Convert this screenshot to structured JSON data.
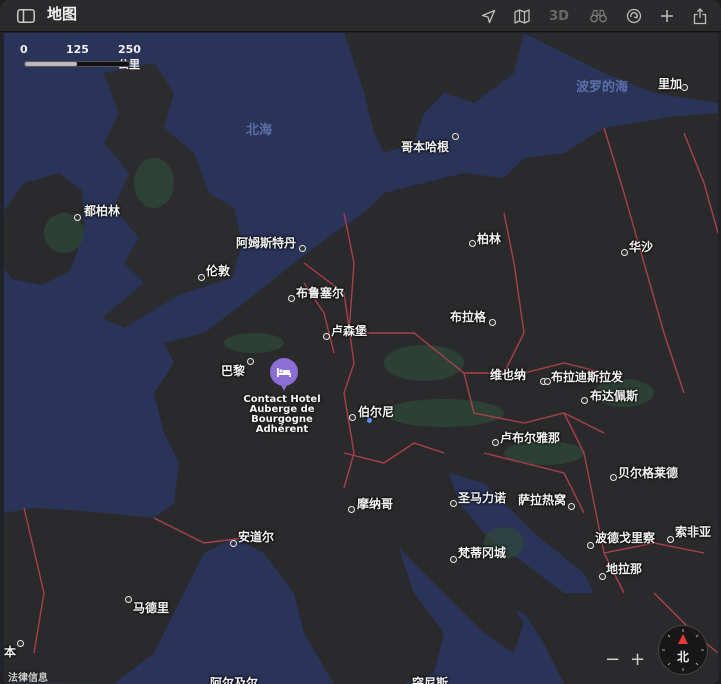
{
  "toolbar": {
    "title": "地图",
    "three_d_label": "3D",
    "icons": [
      "sidebar-icon",
      "location-arrow-icon",
      "map-icon",
      "binoculars-icon",
      "rotate-icon",
      "plus-icon",
      "share-icon"
    ]
  },
  "scale": {
    "ticks": [
      "0",
      "125",
      "250 公里"
    ]
  },
  "seas": {
    "north_sea": "北海",
    "baltic_sea": "波罗的海"
  },
  "cities": {
    "dublin": "都柏林",
    "london": "伦敦",
    "amsterdam": "阿姆斯特丹",
    "brussels": "布鲁塞尔",
    "luxembourg": "卢森堡",
    "paris": "巴黎",
    "bern": "伯尔尼",
    "copenhagen": "哥本哈根",
    "berlin": "柏林",
    "warsaw": "华沙",
    "prague": "布拉格",
    "vienna": "维也纳",
    "bratislava": "布拉迪斯拉发",
    "budapest": "布达佩斯",
    "ljubljana": "卢布尔雅那",
    "monaco": "摩纳哥",
    "san_marino": "圣马力诺",
    "sarajevo": "萨拉热窝",
    "belgrade": "贝尔格莱德",
    "andorra": "安道尔",
    "madrid": "马德里",
    "vatican": "梵蒂冈城",
    "podgorica": "波德戈里察",
    "tirana": "地拉那",
    "sofia": "索非亚",
    "riga": "里加",
    "edge_left": "本",
    "bottom_left": "阿尔及尔",
    "bottom_right": "突尼斯"
  },
  "hotel": {
    "line1": "Contact Hotel",
    "line2": "Auberge de",
    "line3": "Bourgogne",
    "line4": "Adhérent"
  },
  "compass": {
    "north": "北"
  },
  "legal": "法律信息",
  "zoom": {
    "minus": "−",
    "plus": "+"
  }
}
